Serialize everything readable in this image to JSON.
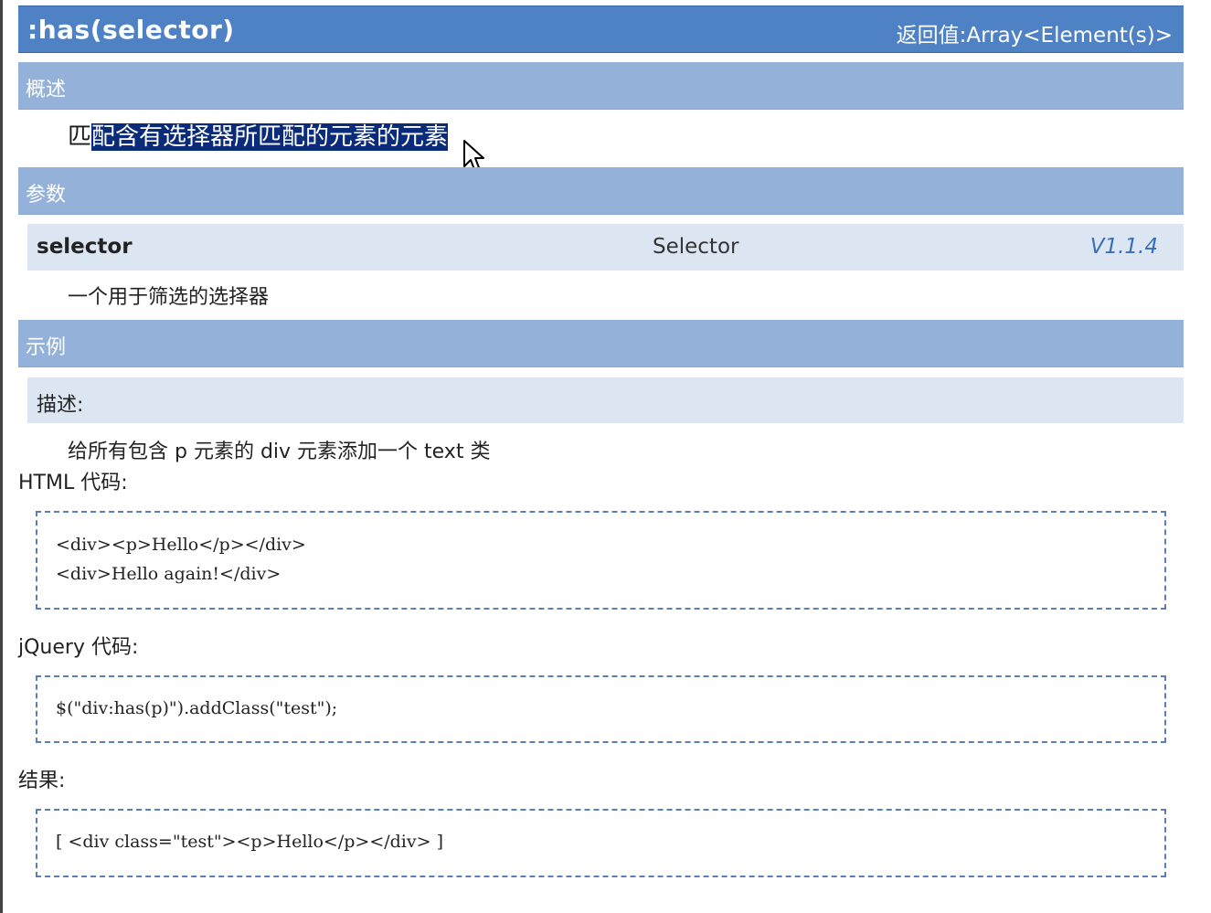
{
  "header": {
    "title": ":has(selector)",
    "return_value": "返回值:Array<Element(s)>"
  },
  "overview": {
    "heading": "概述",
    "text_plain": "匹",
    "text_selected": "配含有选择器所匹配的元素的元素"
  },
  "params": {
    "heading": "参数",
    "name": "selector",
    "type": "Selector",
    "version": "V1.1.4",
    "description": "一个用于筛选的选择器"
  },
  "example": {
    "heading": "示例",
    "desc_label": "描述:",
    "desc_text": "给所有包含 p 元素的 div 元素添加一个 text 类",
    "html_label": "HTML 代码:",
    "html_lines": [
      "<div><p>Hello</p></div>",
      "<div>Hello again!</div>"
    ],
    "jquery_label": "jQuery 代码:",
    "jquery_line": "$(\"div:has(p)\").addClass(\"test\");",
    "result_label": "结果:",
    "result_line": "[ <div class=\"test\"><p>Hello</p></div> ]"
  },
  "icons": {
    "cursor": "mouse-pointer-icon"
  },
  "colors": {
    "title_bar": "#4f82c4",
    "section_bar": "#94b1da",
    "param_row": "#dce6f3",
    "selection": "#0a2a7a",
    "version_text": "#3a6fb8",
    "code_border": "#5a7fb8"
  }
}
